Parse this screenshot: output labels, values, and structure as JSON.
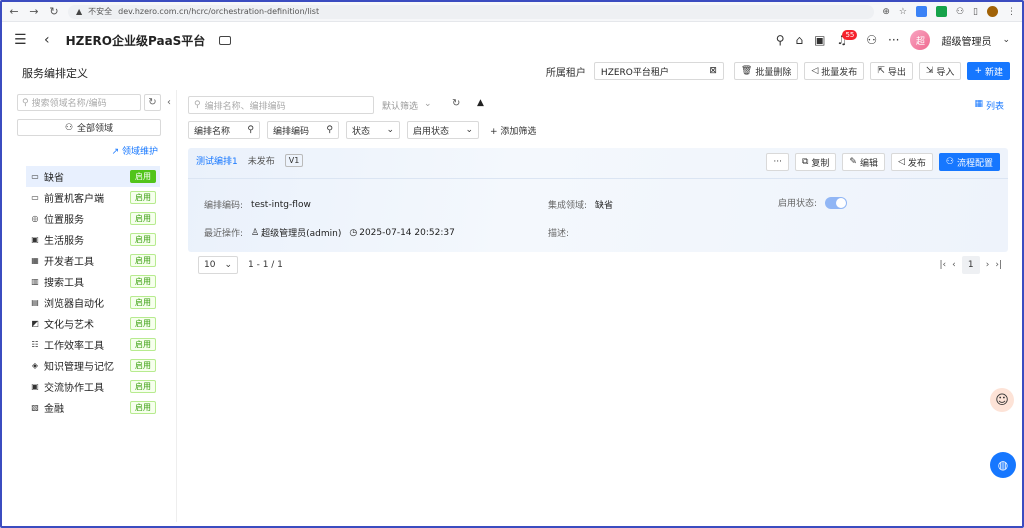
{
  "browser": {
    "insecure_label": "不安全",
    "url": "dev.hzero.com.cn/hcrc/orchestration-definition/list"
  },
  "header": {
    "title": "HZERO企业级PaaS平台",
    "notification_count": "55",
    "avatar_char": "超",
    "user_name": "超级管理员"
  },
  "page": {
    "title": "服务编排定义"
  },
  "toolbar": {
    "tenant_label": "所属租户",
    "tenant_value": "HZERO平台租户",
    "batch_delete": "批量删除",
    "batch_publish": "批量发布",
    "export": "导出",
    "import": "导入",
    "create": "新建"
  },
  "left": {
    "search_placeholder": "搜索领域名称/编码",
    "all_domains": "全部领域",
    "domain_maintain": "领域维护",
    "domains": [
      {
        "name": "缺省",
        "status": "启用",
        "icon": "▭"
      },
      {
        "name": "前置机客户端",
        "status": "启用",
        "icon": "▭"
      },
      {
        "name": "位置服务",
        "status": "启用",
        "icon": "◎"
      },
      {
        "name": "生活服务",
        "status": "启用",
        "icon": "▣"
      },
      {
        "name": "开发者工具",
        "status": "启用",
        "icon": "▦"
      },
      {
        "name": "搜索工具",
        "status": "启用",
        "icon": "▥"
      },
      {
        "name": "浏览器自动化",
        "status": "启用",
        "icon": "▤"
      },
      {
        "name": "文化与艺术",
        "status": "启用",
        "icon": "◩"
      },
      {
        "name": "工作效率工具",
        "status": "启用",
        "icon": "☷"
      },
      {
        "name": "知识管理与记忆",
        "status": "启用",
        "icon": "◈"
      },
      {
        "name": "交流协作工具",
        "status": "启用",
        "icon": "▣"
      },
      {
        "name": "金融",
        "status": "启用",
        "icon": "▧"
      }
    ]
  },
  "main": {
    "search_placeholder": "编排名称、编排编码",
    "default_filter": "默认筛选",
    "list_view": "列表",
    "filters": {
      "name": "编排名称",
      "code": "编排编码",
      "status": "状态",
      "enable_status": "启用状态",
      "add_filter": "添加筛选"
    },
    "card": {
      "name": "测试编排1",
      "status": "未发布",
      "version": "V1",
      "copy": "复制",
      "edit": "编辑",
      "publish": "发布",
      "flow_config": "流程配置",
      "code_label": "编排编码:",
      "code_value": "test-intg-flow",
      "domain_label": "集成领域:",
      "domain_value": "缺省",
      "enable_label": "启用状态:",
      "last_op_label": "最近操作:",
      "last_op_user": "超级管理员(admin)",
      "last_op_time": "2025-07-14 20:52:37",
      "desc_label": "描述:"
    },
    "pager": {
      "page_size": "10",
      "range": "1 - 1 / 1",
      "current": "1"
    }
  }
}
